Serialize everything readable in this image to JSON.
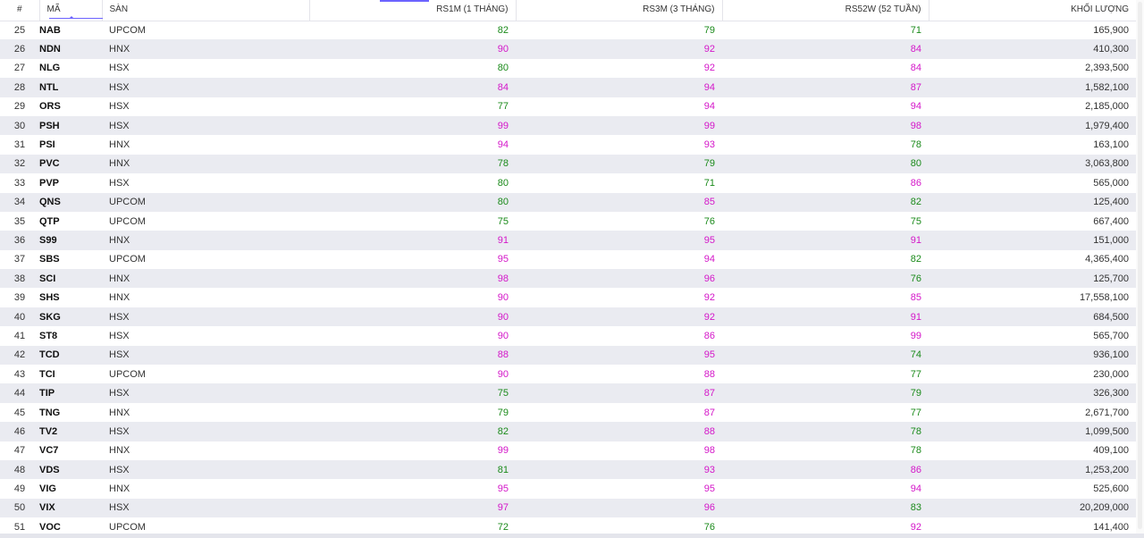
{
  "colors": {
    "green": "#1a8a1a",
    "magenta": "#d416c9",
    "accent": "#6c63ff"
  },
  "headers": {
    "idx": "#",
    "symbol": "MÃ",
    "exchange": "SÀN",
    "rs1m": "RS1M (1 THÁNG)",
    "rs3m": "RS3M (3 THÁNG)",
    "rs52w": "RS52W (52 TUẦN)",
    "volume": "KHỐI LƯỢNG"
  },
  "rows": [
    {
      "idx": "25",
      "symbol": "NAB",
      "exchange": "UPCOM",
      "rs1m": "82",
      "rs3m": "79",
      "rs52w": "71",
      "volume": "165,900"
    },
    {
      "idx": "26",
      "symbol": "NDN",
      "exchange": "HNX",
      "rs1m": "90",
      "rs3m": "92",
      "rs52w": "84",
      "volume": "410,300"
    },
    {
      "idx": "27",
      "symbol": "NLG",
      "exchange": "HSX",
      "rs1m": "80",
      "rs3m": "92",
      "rs52w": "84",
      "volume": "2,393,500"
    },
    {
      "idx": "28",
      "symbol": "NTL",
      "exchange": "HSX",
      "rs1m": "84",
      "rs3m": "94",
      "rs52w": "87",
      "volume": "1,582,100"
    },
    {
      "idx": "29",
      "symbol": "ORS",
      "exchange": "HSX",
      "rs1m": "77",
      "rs3m": "94",
      "rs52w": "94",
      "volume": "2,185,000"
    },
    {
      "idx": "30",
      "symbol": "PSH",
      "exchange": "HSX",
      "rs1m": "99",
      "rs3m": "99",
      "rs52w": "98",
      "volume": "1,979,400"
    },
    {
      "idx": "31",
      "symbol": "PSI",
      "exchange": "HNX",
      "rs1m": "94",
      "rs3m": "93",
      "rs52w": "78",
      "volume": "163,100"
    },
    {
      "idx": "32",
      "symbol": "PVC",
      "exchange": "HNX",
      "rs1m": "78",
      "rs3m": "79",
      "rs52w": "80",
      "volume": "3,063,800"
    },
    {
      "idx": "33",
      "symbol": "PVP",
      "exchange": "HSX",
      "rs1m": "80",
      "rs3m": "71",
      "rs52w": "86",
      "volume": "565,000"
    },
    {
      "idx": "34",
      "symbol": "QNS",
      "exchange": "UPCOM",
      "rs1m": "80",
      "rs3m": "85",
      "rs52w": "82",
      "volume": "125,400"
    },
    {
      "idx": "35",
      "symbol": "QTP",
      "exchange": "UPCOM",
      "rs1m": "75",
      "rs3m": "76",
      "rs52w": "75",
      "volume": "667,400"
    },
    {
      "idx": "36",
      "symbol": "S99",
      "exchange": "HNX",
      "rs1m": "91",
      "rs3m": "95",
      "rs52w": "91",
      "volume": "151,000"
    },
    {
      "idx": "37",
      "symbol": "SBS",
      "exchange": "UPCOM",
      "rs1m": "95",
      "rs3m": "94",
      "rs52w": "82",
      "volume": "4,365,400"
    },
    {
      "idx": "38",
      "symbol": "SCI",
      "exchange": "HNX",
      "rs1m": "98",
      "rs3m": "96",
      "rs52w": "76",
      "volume": "125,700"
    },
    {
      "idx": "39",
      "symbol": "SHS",
      "exchange": "HNX",
      "rs1m": "90",
      "rs3m": "92",
      "rs52w": "85",
      "volume": "17,558,100"
    },
    {
      "idx": "40",
      "symbol": "SKG",
      "exchange": "HSX",
      "rs1m": "90",
      "rs3m": "92",
      "rs52w": "91",
      "volume": "684,500"
    },
    {
      "idx": "41",
      "symbol": "ST8",
      "exchange": "HSX",
      "rs1m": "90",
      "rs3m": "86",
      "rs52w": "99",
      "volume": "565,700"
    },
    {
      "idx": "42",
      "symbol": "TCD",
      "exchange": "HSX",
      "rs1m": "88",
      "rs3m": "95",
      "rs52w": "74",
      "volume": "936,100"
    },
    {
      "idx": "43",
      "symbol": "TCI",
      "exchange": "UPCOM",
      "rs1m": "90",
      "rs3m": "88",
      "rs52w": "77",
      "volume": "230,000"
    },
    {
      "idx": "44",
      "symbol": "TIP",
      "exchange": "HSX",
      "rs1m": "75",
      "rs3m": "87",
      "rs52w": "79",
      "volume": "326,300"
    },
    {
      "idx": "45",
      "symbol": "TNG",
      "exchange": "HNX",
      "rs1m": "79",
      "rs3m": "87",
      "rs52w": "77",
      "volume": "2,671,700"
    },
    {
      "idx": "46",
      "symbol": "TV2",
      "exchange": "HSX",
      "rs1m": "82",
      "rs3m": "88",
      "rs52w": "78",
      "volume": "1,099,500"
    },
    {
      "idx": "47",
      "symbol": "VC7",
      "exchange": "HNX",
      "rs1m": "99",
      "rs3m": "98",
      "rs52w": "78",
      "volume": "409,100"
    },
    {
      "idx": "48",
      "symbol": "VDS",
      "exchange": "HSX",
      "rs1m": "81",
      "rs3m": "93",
      "rs52w": "86",
      "volume": "1,253,200"
    },
    {
      "idx": "49",
      "symbol": "VIG",
      "exchange": "HNX",
      "rs1m": "95",
      "rs3m": "95",
      "rs52w": "94",
      "volume": "525,600"
    },
    {
      "idx": "50",
      "symbol": "VIX",
      "exchange": "HSX",
      "rs1m": "97",
      "rs3m": "96",
      "rs52w": "83",
      "volume": "20,209,000"
    },
    {
      "idx": "51",
      "symbol": "VOC",
      "exchange": "UPCOM",
      "rs1m": "72",
      "rs3m": "76",
      "rs52w": "92",
      "volume": "141,400"
    }
  ]
}
